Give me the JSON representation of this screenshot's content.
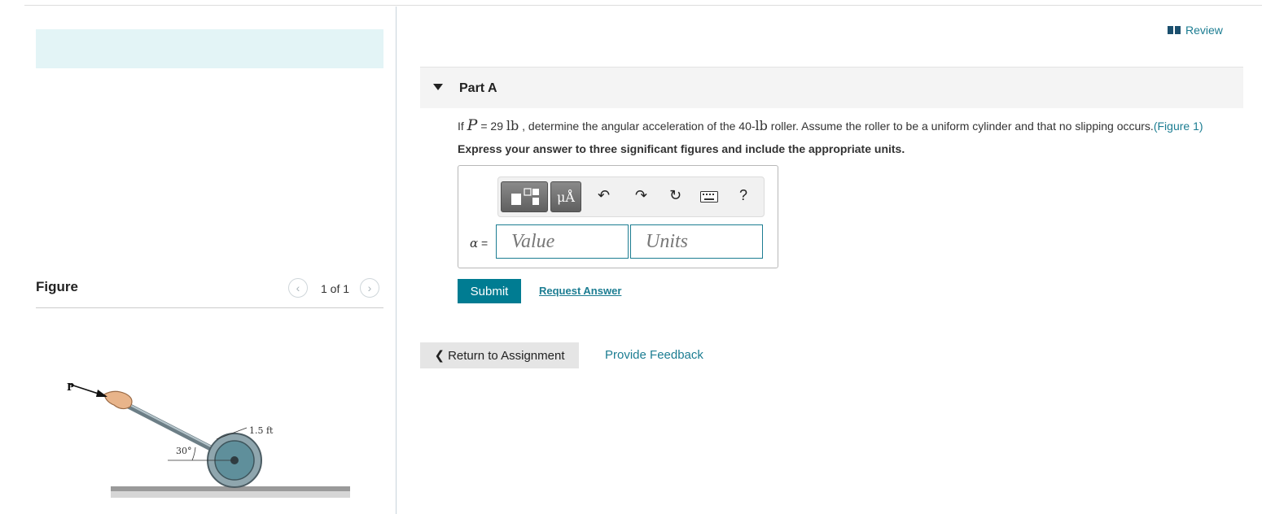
{
  "figure_panel": {
    "title": "Figure",
    "pager": "1 of 1",
    "prev_icon": "chevron-left-icon",
    "next_icon": "chevron-right-icon",
    "diagram_labels": {
      "force": "P",
      "length": "1.5 ft",
      "angle": "30°"
    }
  },
  "header": {
    "review_label": "Review",
    "review_icon": "book-icon"
  },
  "part": {
    "title": "Part A",
    "question_prefix": "If",
    "question_var": "P",
    "question_eq": " = 29 ",
    "question_unit1": "lb",
    "question_mid": " , determine the angular acceleration of the 40-",
    "question_unit2": "lb",
    "question_suffix": " roller. Assume the roller to be a uniform cylinder and that no slipping occurs.",
    "figure_link": "(Figure 1)",
    "instruction": "Express your answer to three significant figures and include the appropriate units."
  },
  "answer": {
    "toolbar": {
      "units_button": "μÅ",
      "help": "?"
    },
    "variable_symbol": "α",
    "equals": " =",
    "value_placeholder": "Value",
    "units_placeholder": "Units"
  },
  "actions": {
    "submit": "Submit",
    "request_answer": "Request Answer",
    "return": "Return to Assignment",
    "feedback": "Provide Feedback"
  },
  "colors": {
    "accent": "#007c92",
    "link": "#1c7d92",
    "banner": "#e3f4f6"
  }
}
